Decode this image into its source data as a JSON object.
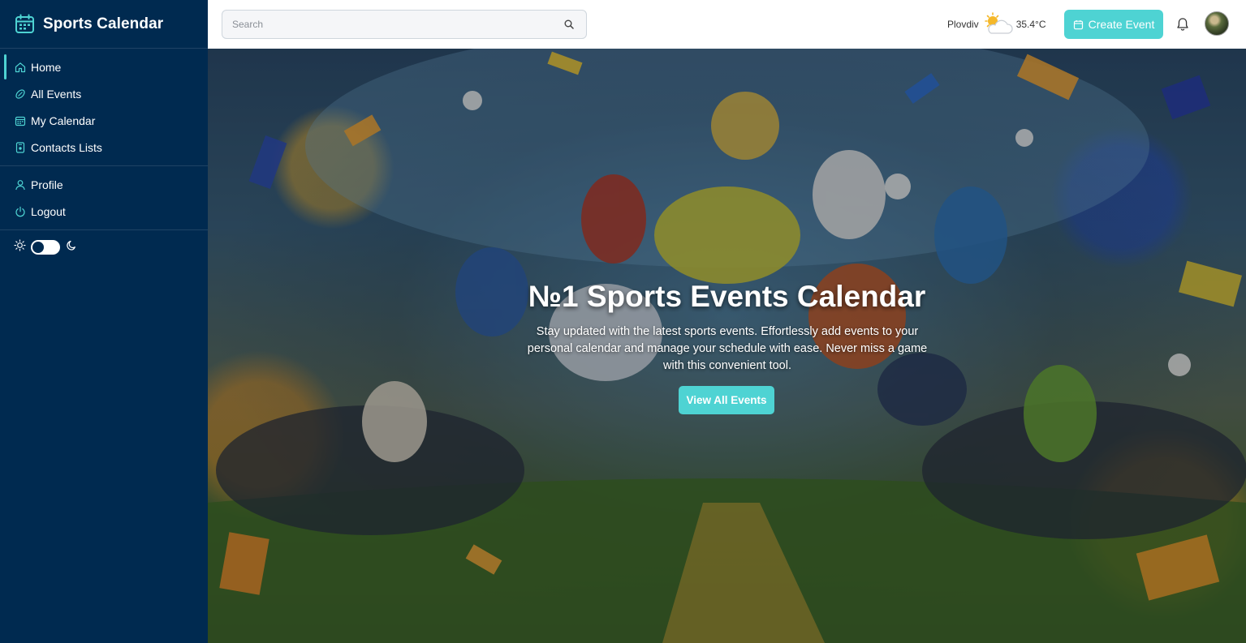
{
  "app": {
    "title": "Sports Calendar"
  },
  "sidebar": {
    "main_items": [
      {
        "label": "Home",
        "icon": "home-icon",
        "active": true
      },
      {
        "label": "All Events",
        "icon": "ball-icon"
      },
      {
        "label": "My Calendar",
        "icon": "calendar-icon"
      },
      {
        "label": "Contacts Lists",
        "icon": "contacts-icon"
      }
    ],
    "account_items": [
      {
        "label": "Profile",
        "icon": "user-icon"
      },
      {
        "label": "Logout",
        "icon": "power-icon"
      }
    ],
    "theme_toggle": {
      "light_icon": "sun-icon",
      "dark_icon": "moon-icon"
    }
  },
  "header": {
    "search_placeholder": "Search",
    "weather": {
      "city": "Plovdiv",
      "temperature": "35.4°C",
      "icon": "partly-sunny-icon"
    },
    "create_event_label": "Create Event"
  },
  "hero": {
    "title": "№1 Sports Events Calendar",
    "description": "Stay updated with the latest sports events. Effortlessly add events to your personal calendar and manage your schedule with ease. Never miss a game with this convenient tool.",
    "button_label": "View All Events"
  },
  "colors": {
    "sidebar_bg": "#002a50",
    "accent": "#4ed3d3",
    "header_bg": "#ffffff"
  }
}
